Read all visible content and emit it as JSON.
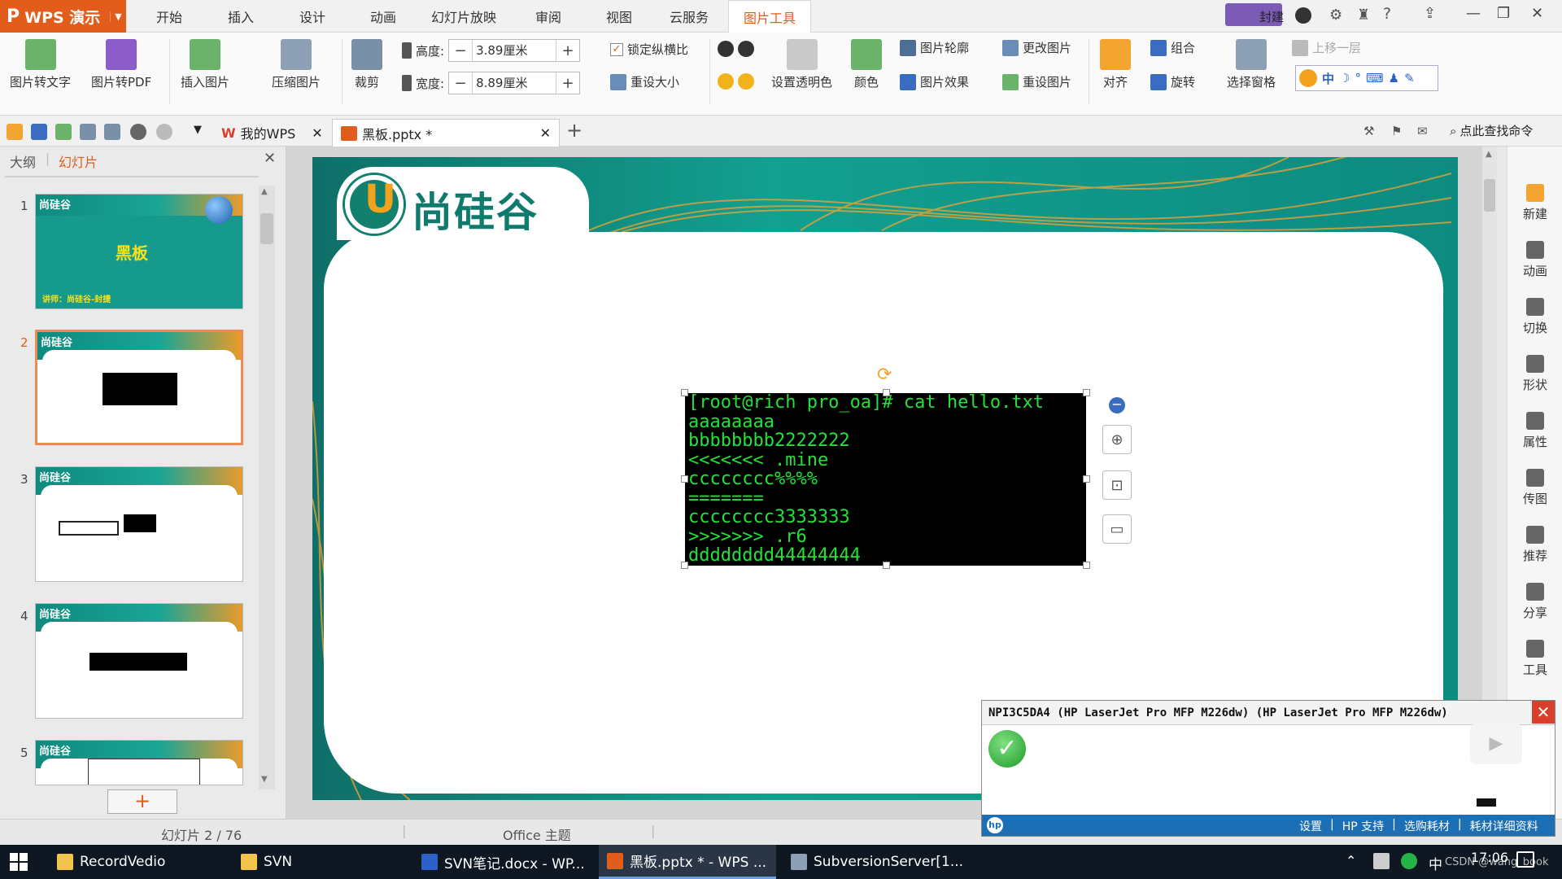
{
  "app": {
    "name": "WPS 演示",
    "tabs": [
      "开始",
      "插入",
      "设计",
      "动画",
      "幻灯片放映",
      "审阅",
      "视图",
      "云服务",
      "图片工具"
    ],
    "active_tab": "图片工具"
  },
  "titlebar": {
    "user_label": "封建",
    "help": "?"
  },
  "ribbon": {
    "pic_to_text": "图片转文字",
    "pic_to_pdf": "图片转PDF",
    "insert_pic": "插入图片",
    "compress": "压缩图片",
    "crop": "裁剪",
    "height_label": "高度:",
    "height_value": "3.89厘米",
    "width_label": "宽度:",
    "width_value": "8.89厘米",
    "lock_ratio": "锁定纵横比",
    "reset_size": "重设大小",
    "set_transparent": "设置透明色",
    "color": "颜色",
    "outline": "图片轮廓",
    "effect": "图片效果",
    "change_pic": "更改图片",
    "reset_pic": "重设图片",
    "align": "对齐",
    "group": "组合",
    "rotate": "旋转",
    "select_pane": "选择窗格",
    "bring_forward": "上移一层"
  },
  "quickbar": {
    "tab1": "我的WPS",
    "tab2": "黑板.pptx *",
    "search": "点此查找命令"
  },
  "leftpane": {
    "tab_outline": "大纲",
    "tab_slides": "幻灯片",
    "slide_numbers": [
      "1",
      "2",
      "3",
      "4",
      "5"
    ],
    "slide1_title": "黑板",
    "slide1_sub": "讲师：尚硅谷-封捷",
    "brand": "尚硅谷"
  },
  "slide": {
    "brand": "尚硅谷",
    "terminal_lines": [
      "[root@rich pro_oa]# cat hello.txt",
      "aaaaaaaa",
      "bbbbbbbb2222222",
      "<<<<<<< .mine",
      "cccccccc%%%%",
      "=======",
      "cccccccc3333333",
      ">>>>>>> .r6",
      "dddddddd44444444"
    ]
  },
  "rightrail": [
    "新建",
    "动画",
    "切换",
    "形状",
    "属性",
    "传图",
    "推荐",
    "分享",
    "工具"
  ],
  "status": {
    "slide_count": "幻灯片 2 / 76",
    "theme": "Office 主题"
  },
  "printer": {
    "title": "NPI3C5DA4 (HP LaserJet Pro MFP M226dw) (HP LaserJet Pro MFP M226dw)",
    "links": [
      "设置",
      "HP 支持",
      "选购耗材",
      "耗材详细资料"
    ]
  },
  "taskbar": {
    "items": [
      "RecordVedio",
      "SVN",
      "SVN笔记.docx - WP...",
      "黑板.pptx * - WPS ...",
      "SubversionServer[1..."
    ],
    "time": "17:06",
    "ime": "中",
    "watermark": "CSDN @wang_book"
  }
}
